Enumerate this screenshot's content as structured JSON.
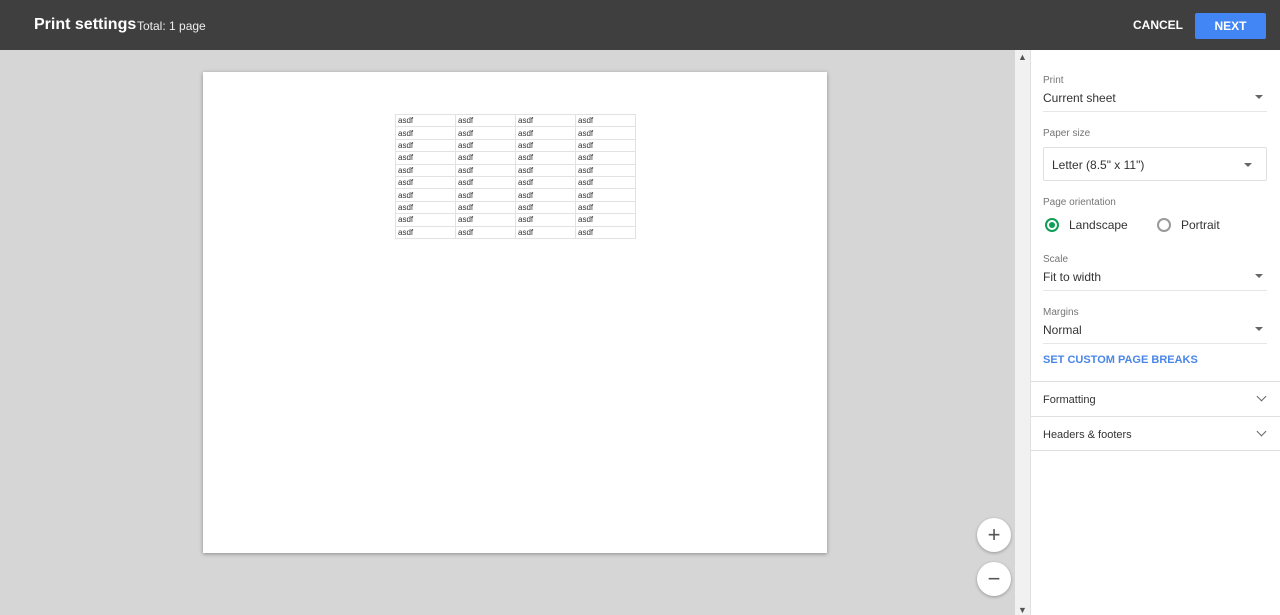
{
  "header": {
    "title": "Print settings",
    "total": "Total: 1 page",
    "cancel_label": "CANCEL",
    "next_label": "NEXT"
  },
  "preview": {
    "rows": [
      [
        "asdf",
        "asdf",
        "asdf",
        "asdf"
      ],
      [
        "asdf",
        "asdf",
        "asdf",
        "asdf"
      ],
      [
        "asdf",
        "asdf",
        "asdf",
        "asdf"
      ],
      [
        "asdf",
        "asdf",
        "asdf",
        "asdf"
      ],
      [
        "asdf",
        "asdf",
        "asdf",
        "asdf"
      ],
      [
        "asdf",
        "asdf",
        "asdf",
        "asdf"
      ],
      [
        "asdf",
        "asdf",
        "asdf",
        "asdf"
      ],
      [
        "asdf",
        "asdf",
        "asdf",
        "asdf"
      ],
      [
        "asdf",
        "asdf",
        "asdf",
        "asdf"
      ],
      [
        "asdf",
        "asdf",
        "asdf",
        "asdf"
      ]
    ],
    "zoom_in": "+",
    "zoom_out": "−"
  },
  "settings": {
    "print_label": "Print",
    "print_value": "Current sheet",
    "paper_label": "Paper size",
    "paper_value": "Letter (8.5\" x 11\")",
    "orientation_label": "Page orientation",
    "landscape": "Landscape",
    "portrait": "Portrait",
    "scale_label": "Scale",
    "scale_value": "Fit to width",
    "margins_label": "Margins",
    "margins_value": "Normal",
    "custom_breaks": "SET CUSTOM PAGE BREAKS",
    "formatting": "Formatting",
    "headers_footers": "Headers & footers"
  },
  "colors": {
    "accent": "#4285f4",
    "radio_selected": "#0f9d58",
    "link": "#4a86e8"
  }
}
